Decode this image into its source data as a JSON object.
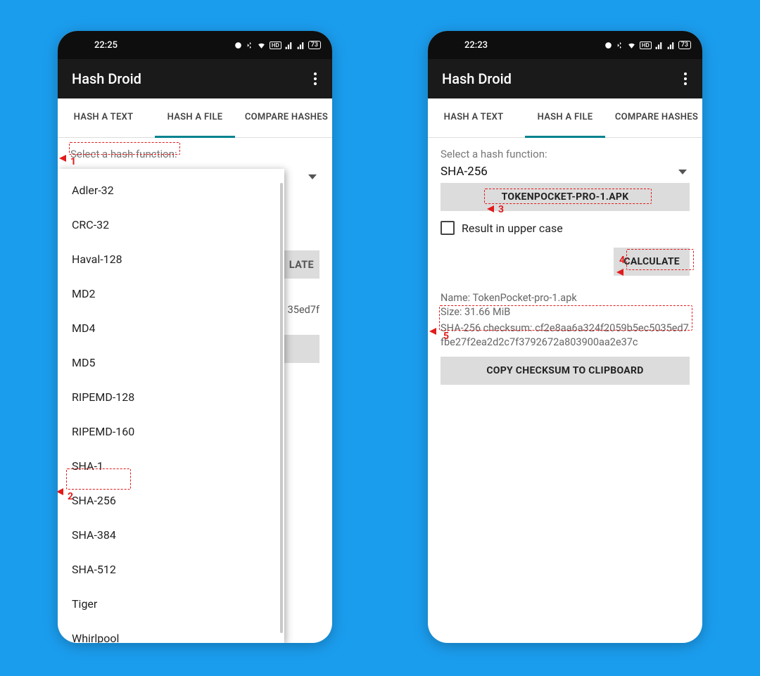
{
  "background_color": "#1b9dee",
  "phones": {
    "left": {
      "statusbar": {
        "time": "22:25",
        "battery": "73"
      },
      "title": "Hash Droid",
      "tabs": [
        "HASH A TEXT",
        "HASH A FILE",
        "COMPARE HASHES"
      ],
      "active_tab": 1,
      "select_label": "Select a hash function:",
      "dropdown_items": [
        "Adler-32",
        "CRC-32",
        "Haval-128",
        "MD2",
        "MD4",
        "MD5",
        "RIPEMD-128",
        "RIPEMD-160",
        "SHA-1",
        "SHA-256",
        "SHA-384",
        "SHA-512",
        "Tiger",
        "Whirlpool"
      ],
      "peek_calc": "LATE",
      "peek_checksum_tail": "35ed7f"
    },
    "right": {
      "statusbar": {
        "time": "22:23",
        "battery": "73"
      },
      "title": "Hash Droid",
      "tabs": [
        "HASH A TEXT",
        "HASH A FILE",
        "COMPARE HASHES"
      ],
      "active_tab": 1,
      "select_label": "Select a hash function:",
      "selected_hash": "SHA-256",
      "file_button": "TOKENPOCKET-PRO-1.APK",
      "uppercase_label": "Result in upper case",
      "calculate": "CALCULATE",
      "result_name": "Name: TokenPocket-pro-1.apk",
      "result_size": "Size: 31.66 MiB",
      "checksum_label": "SHA-256 checksum: ",
      "checksum_value": "cf2e8aa6a324f2059b5ec5035ed7fbe27f2ea2d2c7f3792672a803900aa2e37c",
      "copy_button": "COPY CHECKSUM TO CLIPBOARD"
    }
  },
  "annotations": {
    "1": "1",
    "2": "2",
    "3": "3",
    "4": "4",
    "5": "5"
  }
}
